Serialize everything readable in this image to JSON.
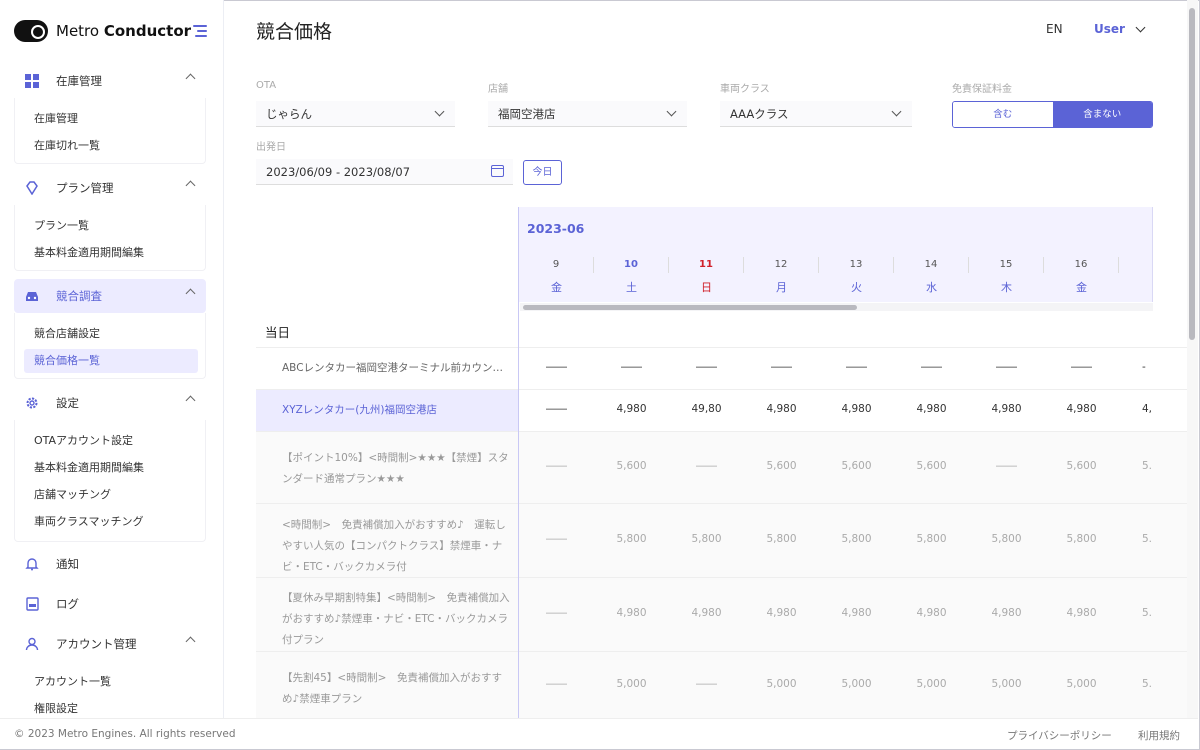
{
  "app": {
    "brand_regular": "Metro ",
    "brand_bold": "Conductor"
  },
  "sidebar": {
    "sections": [
      {
        "label": "在庫管理",
        "icon": "grid-icon",
        "items": [
          "在庫管理",
          "在庫切れ一覧"
        ]
      },
      {
        "label": "プラン管理",
        "icon": "diamond-icon",
        "items": [
          "プラン一覧",
          "基本料金適用期間編集"
        ]
      },
      {
        "label": "競合調査",
        "icon": "car-icon",
        "items": [
          "競合店舗設定",
          "競合価格一覧"
        ],
        "active_item": 1
      },
      {
        "label": "設定",
        "icon": "gear-icon",
        "items": [
          "OTAアカウント設定",
          "基本料金適用期間編集",
          "店舗マッチング",
          "車両クラスマッチング"
        ]
      },
      {
        "label": "通知",
        "icon": "bell-icon",
        "items": []
      },
      {
        "label": "ログ",
        "icon": "log-icon",
        "items": []
      },
      {
        "label": "アカウント管理",
        "icon": "user-icon",
        "items": [
          "アカウント一覧",
          "権限設定"
        ]
      }
    ]
  },
  "header": {
    "title": "競合価格",
    "lang": "EN",
    "user": "User"
  },
  "filters": {
    "ota_label": "OTA",
    "ota_value": "じゃらん",
    "store_label": "店舗",
    "store_value": "福岡空港店",
    "class_label": "車両クラス",
    "class_value": "AAAクラス",
    "insurance_label": "免責保証料金",
    "insurance_include": "含む",
    "insurance_exclude": "含まない",
    "date_label": "出発日",
    "date_value": "2023/06/09 - 2023/08/07",
    "today_button": "今日"
  },
  "grid": {
    "month": "2023-06",
    "days": [
      {
        "num": "9",
        "dow": "金"
      },
      {
        "num": "10",
        "dow": "土"
      },
      {
        "num": "11",
        "dow": "日"
      },
      {
        "num": "12",
        "dow": "月"
      },
      {
        "num": "13",
        "dow": "火"
      },
      {
        "num": "14",
        "dow": "水"
      },
      {
        "num": "15",
        "dow": "木"
      },
      {
        "num": "16",
        "dow": "金"
      }
    ],
    "section_label": "当日",
    "rows": [
      {
        "name": "ABCレンタカー福岡空港ターミナル前カウン…",
        "values": [
          "――",
          "――",
          "――",
          "――",
          "――",
          "――",
          "――",
          "――",
          "-"
        ]
      },
      {
        "name": "XYZレンタカー(九州)福岡空港店",
        "values": [
          "――",
          "4,980",
          "49,80",
          "4,980",
          "4,980",
          "4,980",
          "4,980",
          "4,980",
          "4,"
        ]
      },
      {
        "name": "【ポイント10%】<時間制>★★★【禁煙】スタンダード通常プラン★★★",
        "values": [
          "――",
          "5,600",
          "――",
          "5,600",
          "5,600",
          "5,600",
          "――",
          "5,600",
          "5."
        ]
      },
      {
        "name": "<時間制>　免責補償加入がおすすめ♪　運転しやすい人気の【コンパクトクラス】禁煙車・ナビ・ETC・バックカメラ付",
        "values": [
          "――",
          "5,800",
          "5,800",
          "5,800",
          "5,800",
          "5,800",
          "5,800",
          "5,800",
          "5."
        ]
      },
      {
        "name": "【夏休み早期割特集】<時間制>　免責補償加入がおすすめ♪禁煙車・ナビ・ETC・バックカメラ付プラン",
        "values": [
          "――",
          "4,980",
          "4,980",
          "4,980",
          "4,980",
          "4,980",
          "4,980",
          "4,980",
          "5."
        ]
      },
      {
        "name": "【先割45】<時間制>　免責補償加入がおすすめ♪禁煙車プラン",
        "values": [
          "――",
          "5,000",
          "――",
          "5,000",
          "5,000",
          "5,000",
          "5,000",
          "5,000",
          "5."
        ]
      }
    ]
  },
  "footer": {
    "copyright": "© 2023 Metro Engines. All rights reserved",
    "privacy": "プライバシーポリシー",
    "terms": "利用規約"
  }
}
